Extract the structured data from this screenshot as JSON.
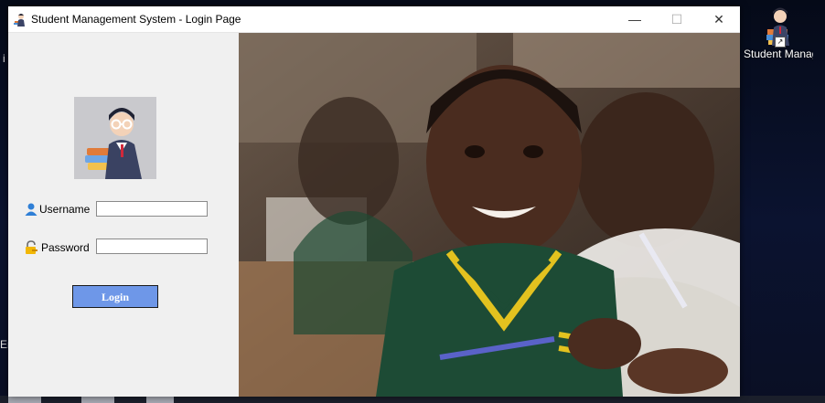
{
  "window": {
    "title": "Student Management System - Login Page",
    "controls": {
      "minimize": "—",
      "maximize": "☐",
      "close": "✕"
    }
  },
  "login": {
    "username_label": "Username",
    "username_value": "",
    "password_label": "Password",
    "password_value": "",
    "login_button": "Login"
  },
  "desktop": {
    "shortcut_label": "Student Manageme...",
    "edge_letters": [
      "i",
      "Er"
    ]
  },
  "colors": {
    "login_button": "#6e97e8",
    "window_bg": "#f0f0f0"
  }
}
